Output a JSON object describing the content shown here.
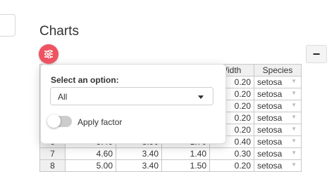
{
  "page": {
    "title": "Charts"
  },
  "colors": {
    "accent": "#ef5361",
    "toggle_off": "#cccccc",
    "header_bg": "#f0f0f0"
  },
  "icons": {
    "fab": "sliders-icon",
    "collapse": "minus-icon"
  },
  "collapse_button": {
    "label": "−"
  },
  "popover": {
    "select_label": "Select an option:",
    "select_value": "All",
    "toggle_label": "Apply factor",
    "toggle_on": false
  },
  "table": {
    "columns": [
      "",
      "",
      "",
      "",
      "al.Width",
      "Species"
    ],
    "rows": [
      {
        "id": "",
        "c1": "",
        "c2": "",
        "c3": "",
        "c4": "0.20",
        "species": "setosa"
      },
      {
        "id": "",
        "c1": "",
        "c2": "",
        "c3": "",
        "c4": "0.20",
        "species": "setosa"
      },
      {
        "id": "",
        "c1": "",
        "c2": "",
        "c3": "",
        "c4": "0.20",
        "species": "setosa"
      },
      {
        "id": "",
        "c1": "",
        "c2": "",
        "c3": "",
        "c4": "0.20",
        "species": "setosa"
      },
      {
        "id": "",
        "c1": "",
        "c2": "",
        "c3": "",
        "c4": "0.20",
        "species": "setosa"
      },
      {
        "id": "6",
        "c1": "5.40",
        "c2": "3.90",
        "c3": "1.70",
        "c4": "0.40",
        "species": "setosa"
      },
      {
        "id": "7",
        "c1": "4.60",
        "c2": "3.40",
        "c3": "1.40",
        "c4": "0.30",
        "species": "setosa"
      },
      {
        "id": "8",
        "c1": "5.00",
        "c2": "3.40",
        "c3": "1.50",
        "c4": "0.20",
        "species": "setosa"
      }
    ]
  }
}
